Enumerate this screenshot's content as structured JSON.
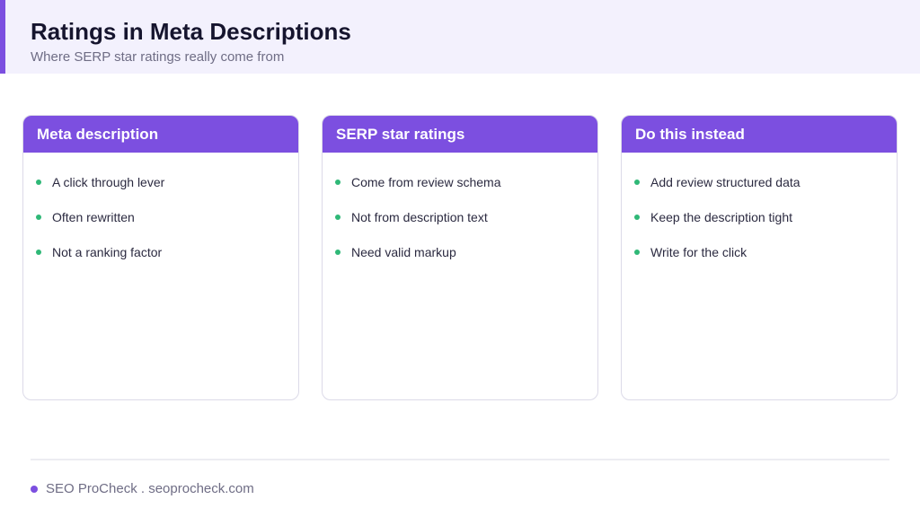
{
  "header": {
    "title": "Ratings in Meta Descriptions",
    "subtitle": "Where SERP star ratings really come from"
  },
  "cards": [
    {
      "title": "Meta description",
      "items": [
        "A click through lever",
        "Often rewritten",
        "Not a ranking factor"
      ]
    },
    {
      "title": "SERP star ratings",
      "items": [
        "Come from review schema",
        "Not from description text",
        "Need valid markup"
      ]
    },
    {
      "title": "Do this instead",
      "items": [
        "Add review structured data",
        "Keep the description tight",
        "Write for the click"
      ]
    }
  ],
  "footer": {
    "text": "SEO ProCheck . seoprocheck.com"
  },
  "colors": {
    "accent": "#7c4fe0",
    "bullet": "#2fb877",
    "header_bg": "#f3f1fd"
  }
}
